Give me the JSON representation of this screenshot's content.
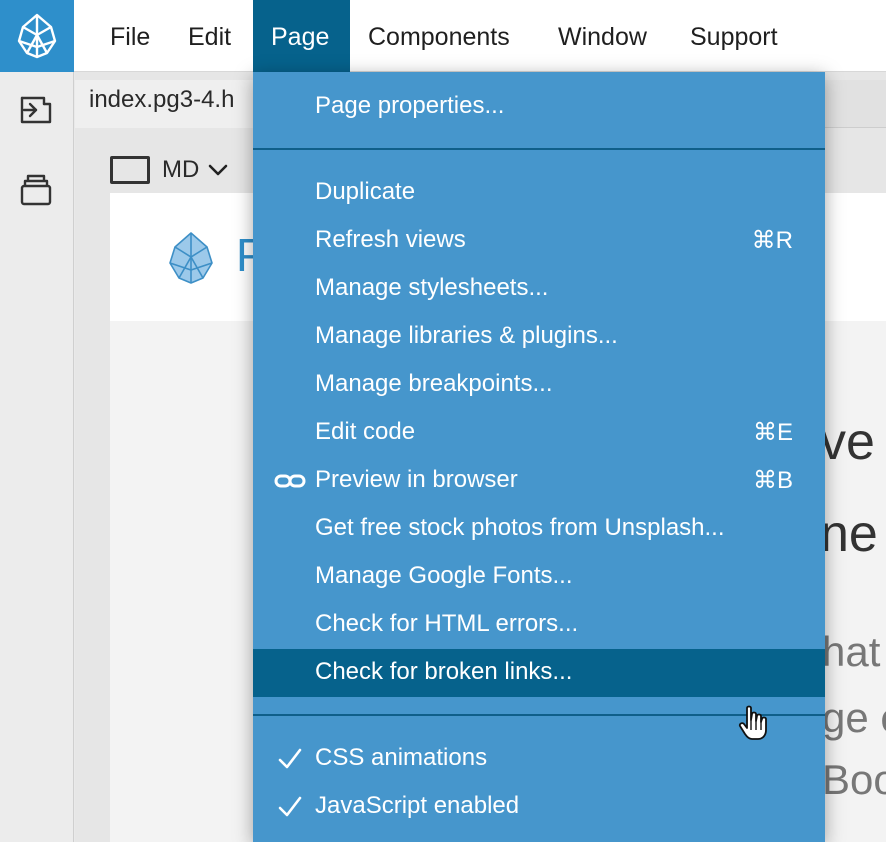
{
  "menubar": {
    "items": [
      {
        "label": "File"
      },
      {
        "label": "Edit"
      },
      {
        "label": "Page"
      },
      {
        "label": "Components"
      },
      {
        "label": "Window"
      },
      {
        "label": "Support"
      }
    ],
    "active": "Page"
  },
  "document": {
    "tab_label": "index.pg3-4.h",
    "breakpoint": "MD"
  },
  "canvas": {
    "logo_letter": "P",
    "fragments": [
      "ve",
      "ne",
      "hat",
      "ge e",
      "Boo"
    ]
  },
  "page_menu": {
    "items": [
      {
        "label": "Page properties...",
        "shortcut": ""
      },
      {
        "label": "Duplicate",
        "shortcut": ""
      },
      {
        "label": "Refresh views",
        "shortcut": "⌘R"
      },
      {
        "label": "Manage stylesheets...",
        "shortcut": ""
      },
      {
        "label": "Manage libraries & plugins...",
        "shortcut": ""
      },
      {
        "label": "Manage breakpoints...",
        "shortcut": ""
      },
      {
        "label": "Edit code",
        "shortcut": "⌘E"
      },
      {
        "label": "Preview in browser",
        "shortcut": "⌘B"
      },
      {
        "label": "Get free stock photos from Unsplash...",
        "shortcut": ""
      },
      {
        "label": "Manage Google Fonts...",
        "shortcut": ""
      },
      {
        "label": "Check for HTML errors...",
        "shortcut": ""
      },
      {
        "label": "Check for broken links...",
        "shortcut": ""
      },
      {
        "label": "CSS animations",
        "shortcut": "",
        "checked": true
      },
      {
        "label": "JavaScript enabled",
        "shortcut": "",
        "checked": true
      }
    ],
    "highlighted": "Check for broken links..."
  },
  "colors": {
    "brand": "#2e8fcb",
    "menu_bg": "#4696cc",
    "menu_highlight": "#06628c",
    "separator": "#0f5f8a"
  },
  "icons": {
    "app_logo": "pinegrow-cone-icon",
    "sidebar": [
      "import-arrow-icon",
      "library-box-icon"
    ],
    "preview": "link-chain-icon",
    "check": "checkmark-icon",
    "cursor": "hand-pointer-icon"
  }
}
